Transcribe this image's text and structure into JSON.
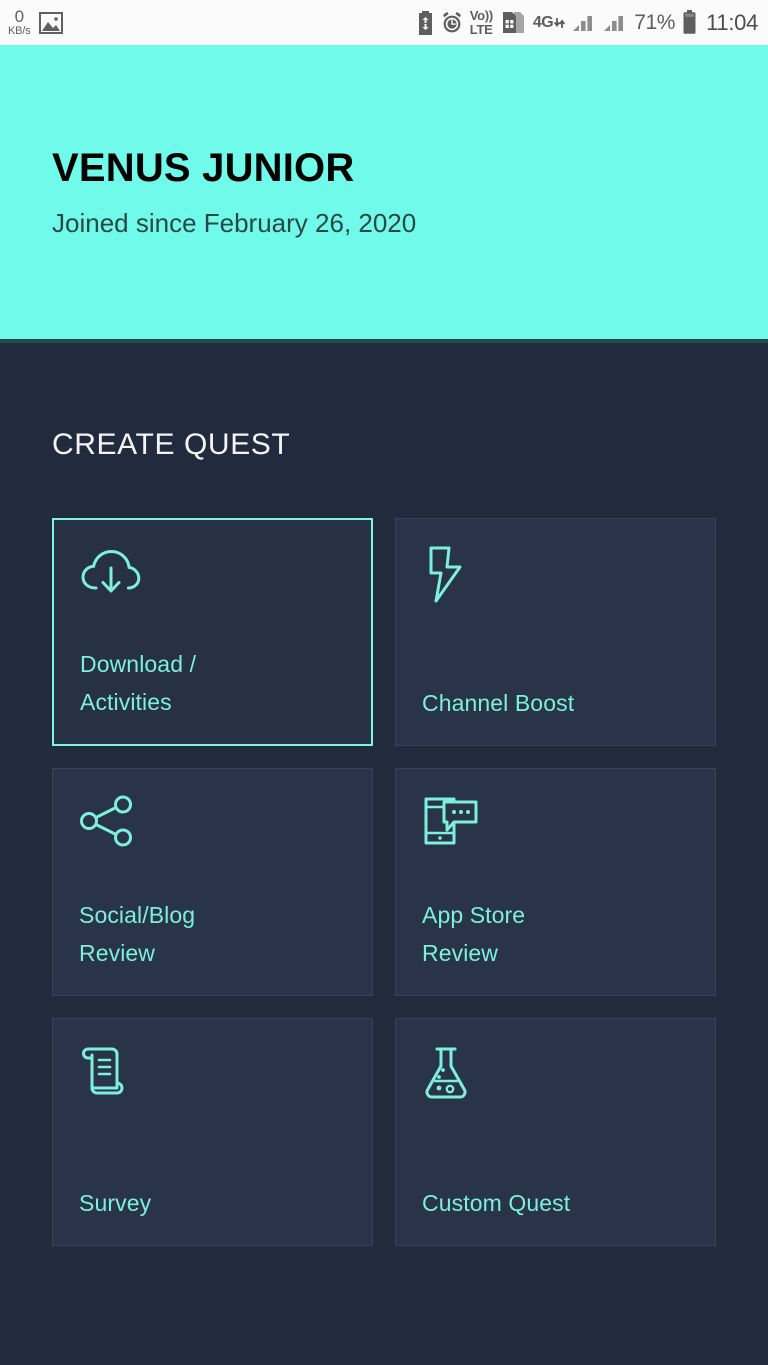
{
  "status_bar": {
    "network_speed_value": "0",
    "network_speed_unit": "KB/s",
    "gallery_icon": "image-icon",
    "battery_saver_icon": "battery-saver-icon",
    "alarm_icon": "alarm-clock-icon",
    "volte_line1": "Vo))",
    "volte_line2": "LTE",
    "sim_icon": "sim-card-icon",
    "network_type": "4G",
    "data_arrows": "data-transfer-arrows-icon",
    "signal_icon_1": "signal-bars-icon",
    "signal_icon_2": "signal-bars-icon",
    "battery_percent": "71%",
    "battery_icon": "battery-icon",
    "clock": "11:04"
  },
  "profile": {
    "name": "VENUS JUNIOR",
    "joined": "Joined since February 26, 2020",
    "header_bg": "#6FFAEA",
    "name_color": "#030303",
    "joined_color": "#2B4747"
  },
  "theme": {
    "page_bg": "#222B3D",
    "card_bg": "#29344A",
    "card_border": "#384359",
    "accent": "#7CF6E3",
    "label_color": "#7DF0DD",
    "heading_color": "#F2F5F8"
  },
  "main": {
    "section_title": "CREATE QUEST",
    "quests": [
      {
        "label": "Download /\nActivities",
        "icon": "cloud-download-icon",
        "selected": true
      },
      {
        "label": "Channel Boost",
        "icon": "lightning-bolt-icon",
        "selected": false
      },
      {
        "label": "Social/Blog\nReview",
        "icon": "share-nodes-icon",
        "selected": false
      },
      {
        "label": "App Store\nReview",
        "icon": "mobile-chat-icon",
        "selected": false
      },
      {
        "label": "Survey",
        "icon": "scroll-document-icon",
        "selected": false
      },
      {
        "label": "Custom Quest",
        "icon": "flask-icon",
        "selected": false
      }
    ]
  }
}
